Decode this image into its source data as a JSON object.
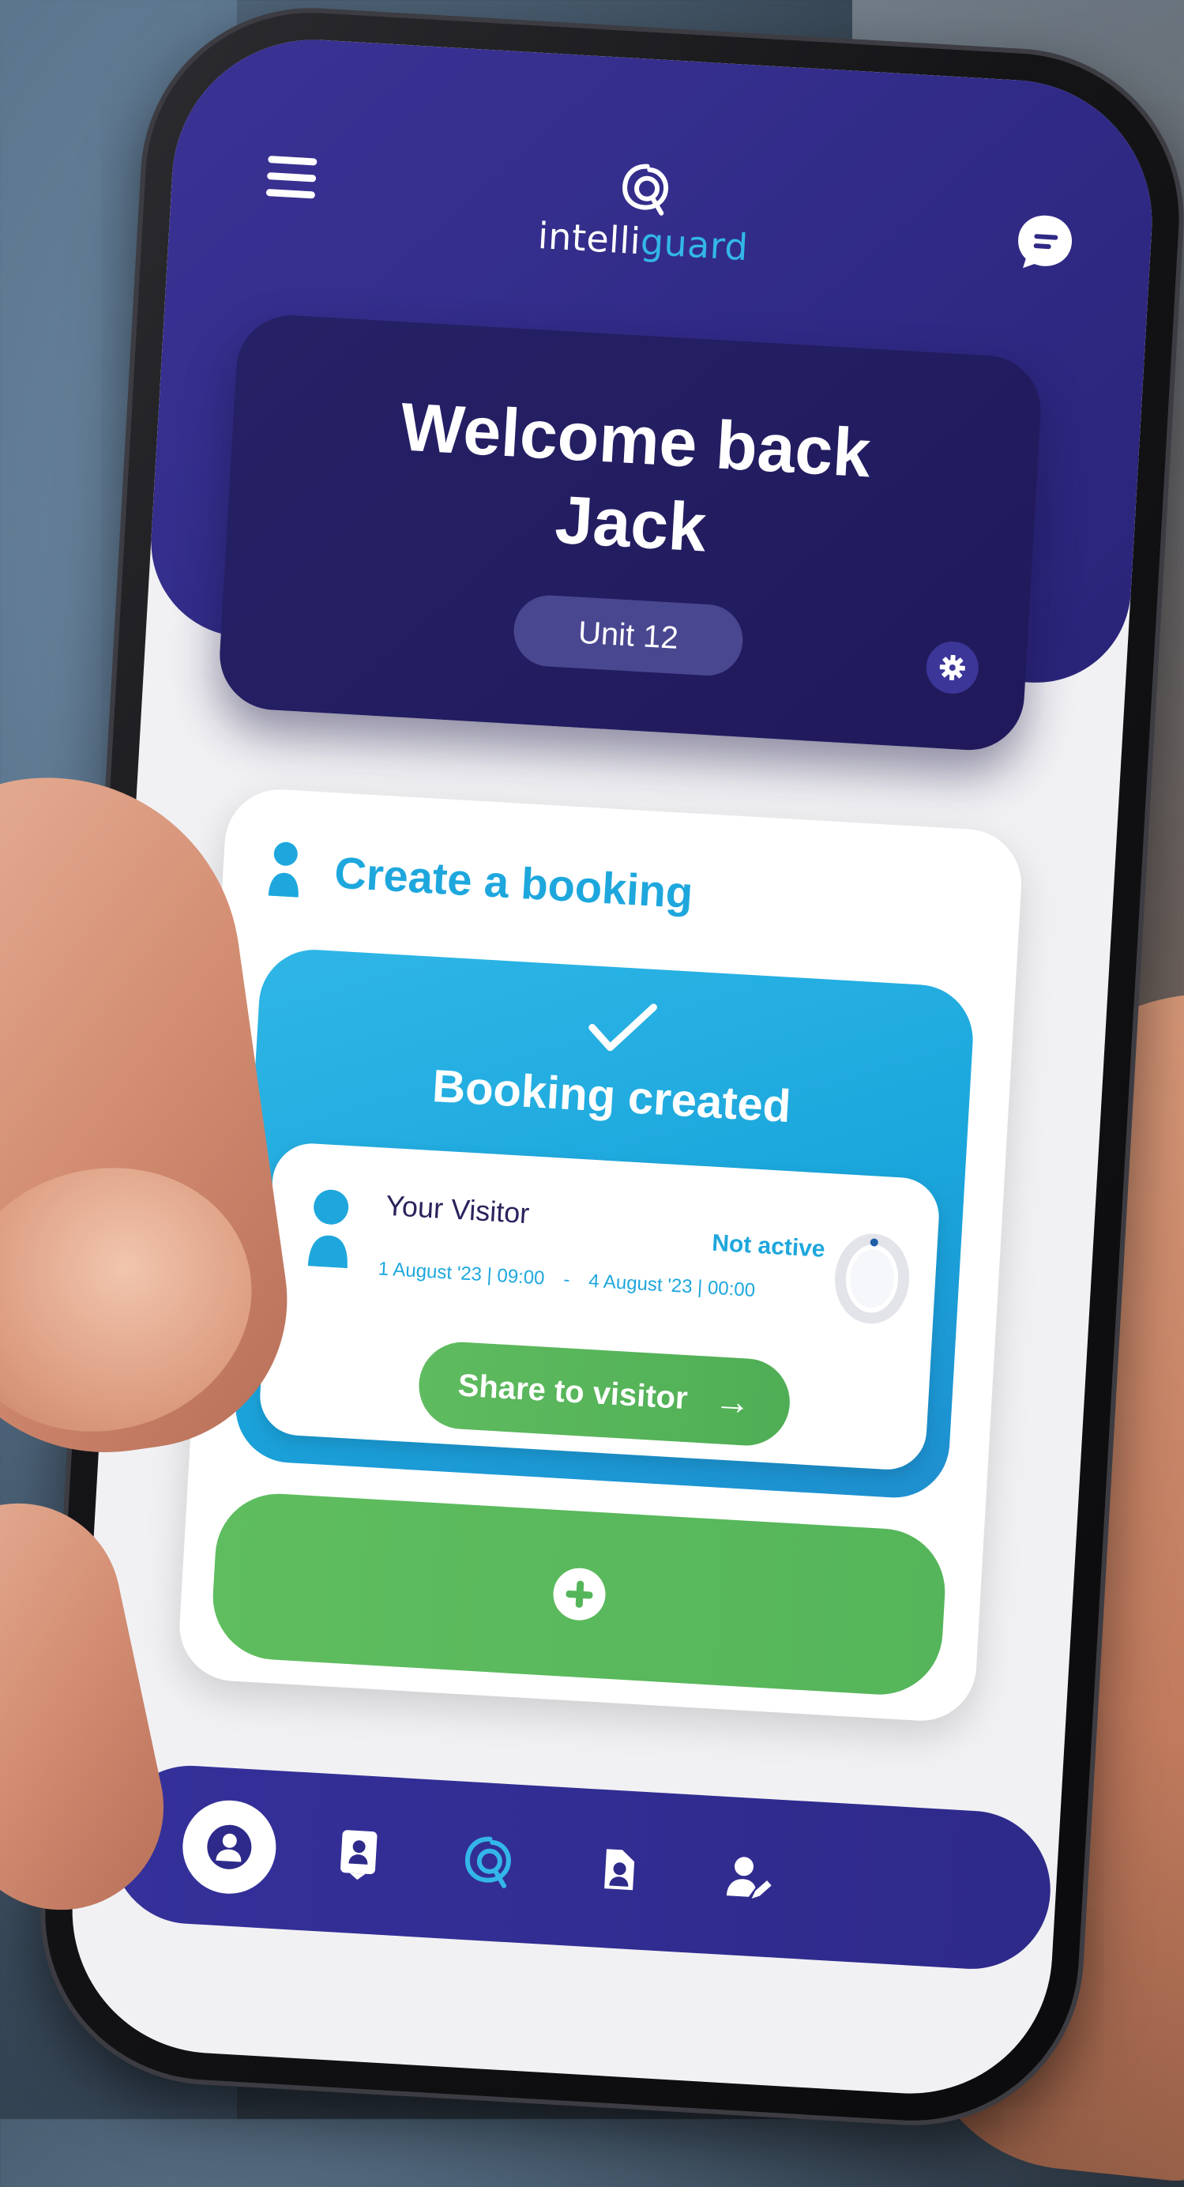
{
  "app": {
    "brand_prefix": "intelli",
    "brand_accent": "guard",
    "colors": {
      "header": "#302a86",
      "card_dark": "#231d62",
      "accent_blue": "#1ea7dd",
      "accent_green": "#55b55a"
    }
  },
  "header": {
    "menu_icon": "hamburger-icon",
    "chat_icon": "chat-bubble-icon"
  },
  "welcome": {
    "line1": "Welcome back",
    "line2": "Jack",
    "unit": "Unit 12",
    "settings_icon": "gear-icon"
  },
  "booking": {
    "section_title": "Create a booking",
    "status_title": "Booking created",
    "visitor": {
      "name": "Your Visitor",
      "status": "Not active",
      "start": "1 August '23 | 09:00",
      "separator": "-",
      "end": "4 August '23 | 00:00"
    },
    "share_label": "Share to visitor",
    "add_icon": "plus-circle-icon"
  },
  "nav": {
    "items": [
      {
        "icon": "profile-icon",
        "active": true
      },
      {
        "icon": "id-badge-icon",
        "active": false
      },
      {
        "icon": "intelliguard-logo-icon",
        "active": false
      },
      {
        "icon": "visitor-pass-icon",
        "active": false
      },
      {
        "icon": "edit-user-icon",
        "active": false
      }
    ]
  }
}
